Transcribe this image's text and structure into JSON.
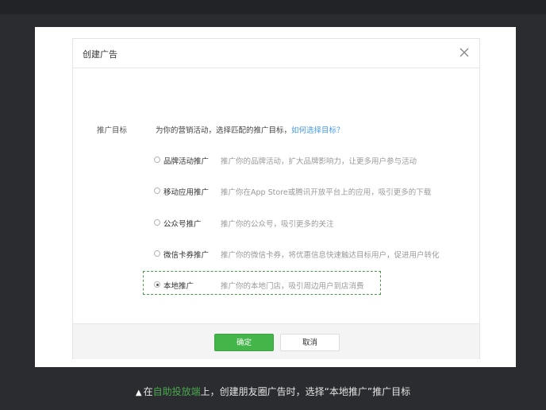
{
  "dialog": {
    "title": "创建广告",
    "close_label": "×"
  },
  "form": {
    "label": "推广目标",
    "description": "为你的营销活动，选择匹配的推广目标，",
    "help_link": "如何选择目标？"
  },
  "options": [
    {
      "name": "品牌活动推广",
      "desc": "推广你的品牌活动，扩大品牌影响力，让更多用户参与活动",
      "selected": false
    },
    {
      "name": "移动应用推广",
      "desc": "推广你在App Store或腾讯开放平台上的应用，吸引更多的下载",
      "selected": false
    },
    {
      "name": "公众号推广",
      "desc": "推广你的公众号，吸引更多的关注",
      "selected": false
    },
    {
      "name": "微信卡券推广",
      "desc": "推广你的微信卡券，将优惠信息快速触达目标用户，促进用户转化",
      "selected": false
    },
    {
      "name": "本地推广",
      "desc": "推广你的本地门店，吸引周边用户到店消费",
      "selected": true
    }
  ],
  "footer": {
    "confirm_label": "确定",
    "cancel_label": "取消"
  },
  "caption": {
    "triangle": "▲",
    "prefix": "在",
    "highlight": "自助投放端",
    "suffix": "上，创建朋友圈广告时，选择“本地推广”推广目标"
  },
  "colors": {
    "accent_green": "#44b549",
    "link_blue": "#459ae9",
    "highlight_dashed": "#4a9a4a",
    "page_bg": "#2b2c30"
  }
}
